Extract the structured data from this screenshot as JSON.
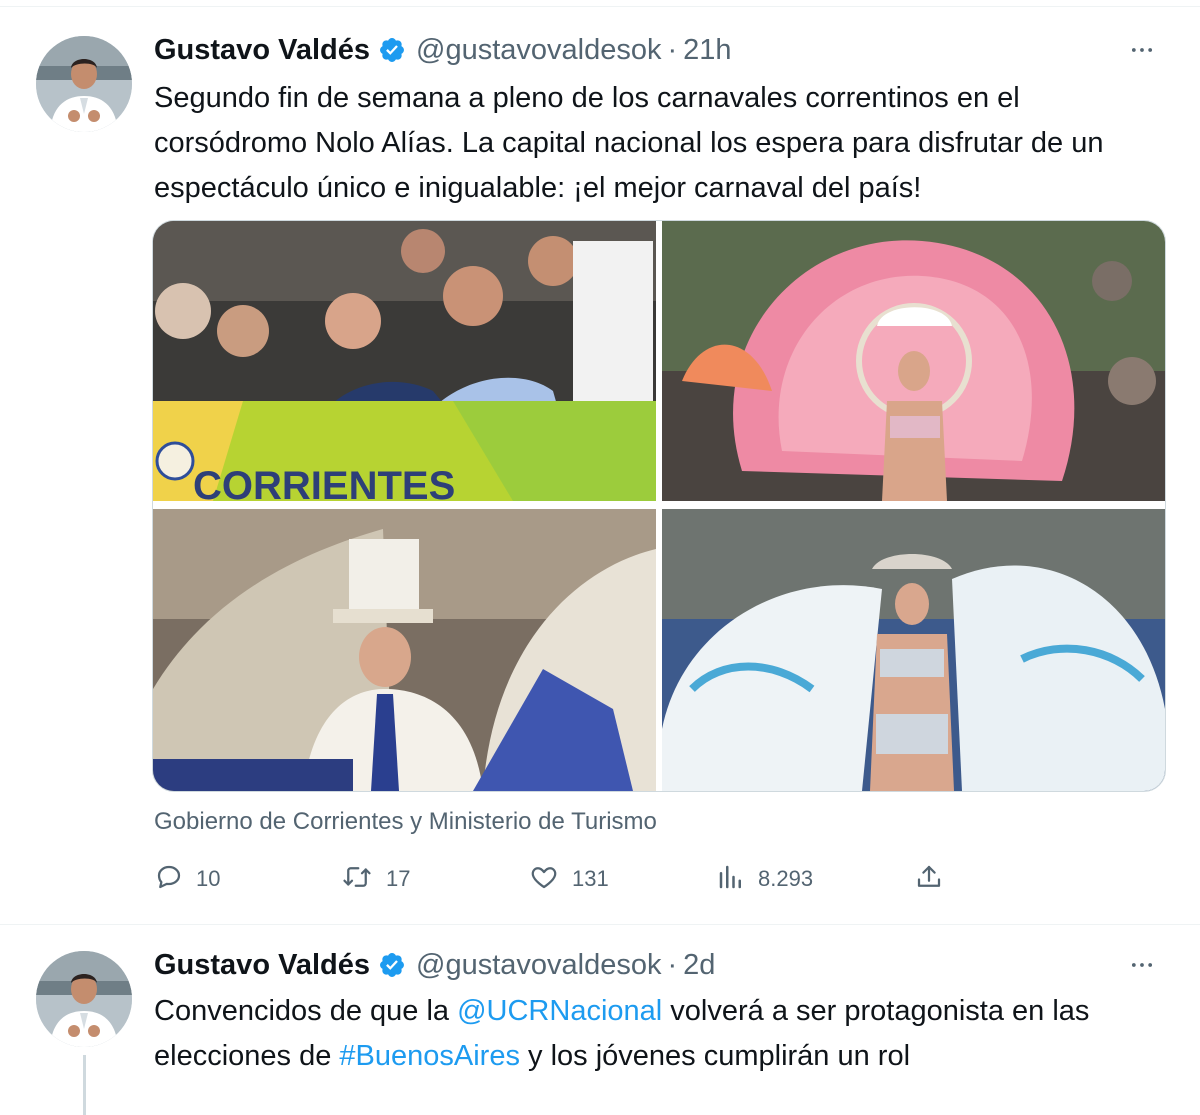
{
  "tweets": [
    {
      "author": {
        "name": "Gustavo Valdés",
        "handle": "@gustavovaldesok",
        "verified": true
      },
      "time": "21h",
      "separator": "·",
      "text": "Segundo fin de semana a pleno de los carnavales correntinos en el corsódromo Nolo Alías. La capital nacional los espera para disfrutar de un espectáculo único e inigualable: ¡el mejor carnaval del país!",
      "media_caption": "Gobierno de Corrientes y Ministerio de Turismo",
      "photo_banner_text": "CORRIENTES",
      "stats": {
        "replies": "10",
        "retweets": "17",
        "likes": "131",
        "views": "8.293"
      }
    },
    {
      "author": {
        "name": "Gustavo Valdés",
        "handle": "@gustavovaldesok",
        "verified": true
      },
      "time": "2d",
      "separator": "·",
      "text_parts": [
        {
          "text": "Convencidos de que la ",
          "link": false
        },
        {
          "text": "@UCRNacional",
          "link": true
        },
        {
          "text": " volverá a ser protagonista en las elecciones de ",
          "link": false
        },
        {
          "text": "#BuenosAires",
          "link": true
        },
        {
          "text": " y los jóvenes cumplirán un rol",
          "link": false
        }
      ]
    }
  ],
  "colors": {
    "link": "#1d9bf0",
    "verified": "#1d9bf0",
    "secondary_text": "#536471",
    "divider": "#eff3f4"
  },
  "icons": [
    "verified-badge-icon",
    "more-icon",
    "reply-icon",
    "retweet-icon",
    "like-icon",
    "views-icon",
    "share-icon"
  ]
}
